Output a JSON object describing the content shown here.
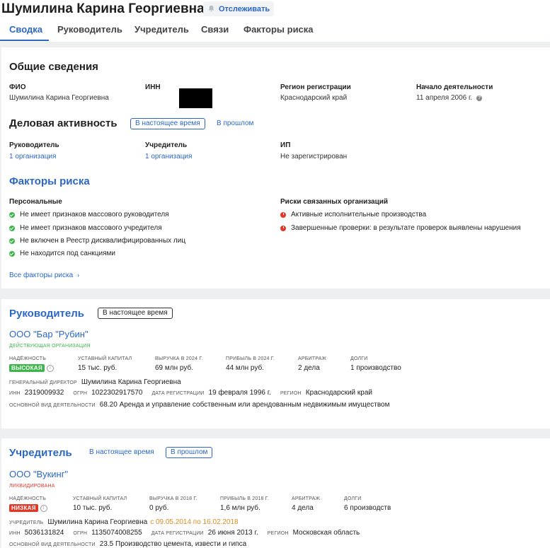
{
  "header": {
    "name": "Шумилина Карина Георгиевна",
    "track_label": "Отслеживать",
    "tabs": [
      "Сводка",
      "Руководитель",
      "Учредитель",
      "Связи",
      "Факторы риска"
    ]
  },
  "general": {
    "title": "Общие сведения",
    "fio_label": "ФИО",
    "fio_value": "Шумилина Карина Георгиевна",
    "inn_label": "ИНН",
    "region_label": "Регион регистрации",
    "region_value": "Краснодарский край",
    "start_label": "Начало деятельности",
    "start_value": "11 апреля 2006 г."
  },
  "activity": {
    "title": "Деловая активность",
    "now_label": "В настоящее время",
    "past_label": "В прошлом",
    "manager_label": "Руководитель",
    "manager_value": "1 организация",
    "founder_label": "Учредитель",
    "founder_value": "1 организация",
    "ip_label": "ИП",
    "ip_value": "Не зарегистрирован"
  },
  "risk": {
    "title": "Факторы риска",
    "personal_label": "Персональные",
    "personal_items": [
      "Не имеет признаков массового руководителя",
      "Не имеет признаков массового учредителя",
      "Не включен в Реестр дисквалифицированных лиц",
      "Не находится под санкциями"
    ],
    "related_label": "Риски связанных организаций",
    "related_items": [
      "Активные исполнительные производства",
      "Завершенные проверки: в результате проверок выявлены нарушения"
    ],
    "all_link": "Все факторы риска",
    "colors": {
      "ok": "#3db54a",
      "bad": "#e0392a"
    }
  },
  "manager_card": {
    "title": "Руководитель",
    "filter_now": "В настоящее время",
    "company": "ООО \"Бар \"Рубин\"",
    "status": "ДЕЙСТВУЮЩАЯ ОРГАНИЗАЦИЯ",
    "reliability_label": "НАДЁЖНОСТЬ",
    "reliability_value": "ВЫСОКАЯ",
    "capital_label": "УСТАВНЫЙ КАПИТАЛ",
    "capital_value": "15 тыс. руб.",
    "revenue_label": "ВЫРУЧКА В 2024 Г.",
    "revenue_value": "69 млн руб.",
    "profit_label": "ПРИБЫЛЬ В 2024 Г.",
    "profit_value": "44 млн руб.",
    "arbitration_label": "АРБИТРАЖ",
    "arbitration_value": "2 дела",
    "debts_label": "ДОЛГИ",
    "debts_value": "1 производство",
    "director_label": "ГЕНЕРАЛЬНЫЙ ДИРЕКТОР",
    "director_value": "Шумилина Карина Георгиевна",
    "inn_label": "ИНН",
    "inn_value": "2319009932",
    "ogrn_label": "ОГРН",
    "ogrn_value": "1022302917570",
    "regdate_label": "ДАТА РЕГИСТРАЦИИ",
    "regdate_value": "19 февраля 1996 г.",
    "region_label": "РЕГИОН",
    "region_value": "Краснодарский край",
    "okved_label": "ОСНОВНОЙ ВИД ДЕЯТЕЛЬНОСТИ",
    "okved_value": "68.20 Аренда и управление собственным или арендованным недвижимым имуществом"
  },
  "founder_card": {
    "title": "Учредитель",
    "filter_now": "В настоящее время",
    "filter_past": "В прошлом",
    "company": "ООО \"Вукинг\"",
    "status": "ЛИКВИДИРОВАНА",
    "reliability_label": "НАДЁЖНОСТЬ",
    "reliability_value": "НИЗКАЯ",
    "capital_label": "УСТАВНЫЙ КАПИТАЛ",
    "capital_value": "10 тыс. руб.",
    "revenue_label": "ВЫРУЧКА В 2018 Г.",
    "revenue_value": "0 руб.",
    "profit_label": "ПРИБЫЛЬ В 2018 Г.",
    "profit_value": "1,6 млн руб.",
    "arbitration_label": "АРБИТРАЖ",
    "arbitration_value": "4 дела",
    "debts_label": "ДОЛГИ",
    "debts_value": "6 производств",
    "founder_label": "УЧРЕДИТЕЛЬ",
    "founder_value": "Шумилина Карина Георгиевна",
    "founder_period": "с 09.05.2014 по 16.02.2018",
    "inn_label": "ИНН",
    "inn_value": "5036131824",
    "ogrn_label": "ОГРН",
    "ogrn_value": "1135074008255",
    "regdate_label": "ДАТА РЕГИСТРАЦИИ",
    "regdate_value": "26 июня 2013 г.",
    "region_label": "РЕГИОН",
    "region_value": "Московская область",
    "okved_label": "ОСНОВНОЙ ВИД ДЕЯТЕЛЬНОСТИ",
    "okved_value": "23.5 Производство цемента, извести и гипса"
  }
}
